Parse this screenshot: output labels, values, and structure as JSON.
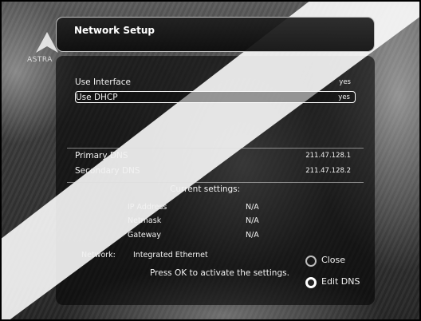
{
  "logo": {
    "text": "ASTRA"
  },
  "header": {
    "title": "Network Setup"
  },
  "settings": [
    {
      "label": "Use Interface",
      "value": "yes"
    },
    {
      "label": "Use DHCP",
      "value": "yes"
    }
  ],
  "dns": [
    {
      "label": "Primary DNS",
      "value": "211.47.128.1"
    },
    {
      "label": "Secondary DNS",
      "value": "211.47.128.2"
    }
  ],
  "current": {
    "heading": "Current settings:",
    "items": [
      {
        "label": "IP Address",
        "value": "N/A"
      },
      {
        "label": "Netmask",
        "value": "N/A"
      },
      {
        "label": "Gateway",
        "value": "N/A"
      }
    ]
  },
  "network": {
    "label": "Network:",
    "value": "Integrated Ethernet"
  },
  "hint": "Press OK to activate the settings.",
  "buttons": {
    "close": "Close",
    "edit_dns": "Edit DNS"
  },
  "icons": [
    "astra-logo-icon",
    "close-circle-icon",
    "edit-dns-circle-icon"
  ],
  "colors": {
    "text": "#f2f2f2",
    "panel": "#0a0a0a",
    "border": "#bdbdbd"
  }
}
